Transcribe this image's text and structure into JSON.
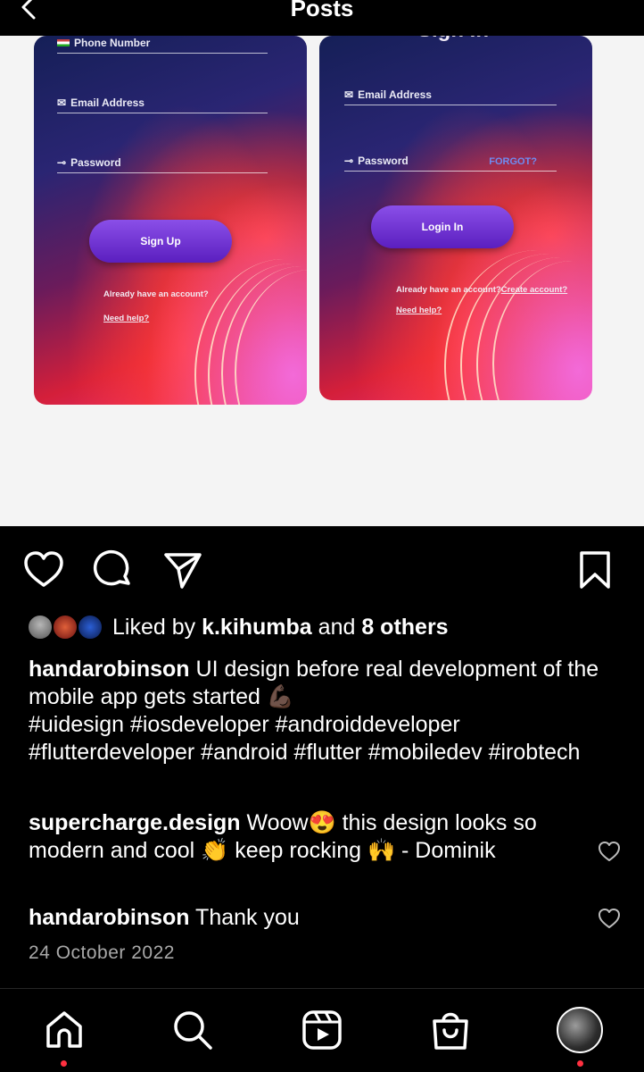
{
  "header": {
    "title": "Posts"
  },
  "post_image": {
    "left_screen": {
      "fields": [
        "Phone Number",
        "Email Address",
        "Password"
      ],
      "button": "Sign Up",
      "account_text": "Already have an account?",
      "help_text": "Need help?"
    },
    "right_screen": {
      "title": "Sign In",
      "fields": [
        "Email Address",
        "Password"
      ],
      "forgot": "FORGOT?",
      "button": "Login In",
      "account_text": "Already have an account?",
      "create_text": "Create account?",
      "help_text": "Need help?"
    }
  },
  "likes": {
    "prefix": "Liked by ",
    "user": "k.kihumba",
    "middle": " and ",
    "others": "8 others"
  },
  "caption": {
    "user": "handarobinson",
    "text": " UI design before real development of the mobile app gets started 💪🏿",
    "hashtags": "#uidesign #iosdeveloper #androiddeveloper #flutterdeveloper #android #flutter #mobiledev #irobtech"
  },
  "comments": [
    {
      "user": "supercharge.design",
      "text": " Woow😍 this design looks so modern and cool 👏 keep rocking 🙌 - Dominik"
    },
    {
      "user": "handarobinson",
      "text": " Thank you"
    }
  ],
  "date": "24 October 2022",
  "colors": {
    "background": "#000000",
    "accent_dot": "#ff3040",
    "secondary_text": "#a8a8a8"
  }
}
